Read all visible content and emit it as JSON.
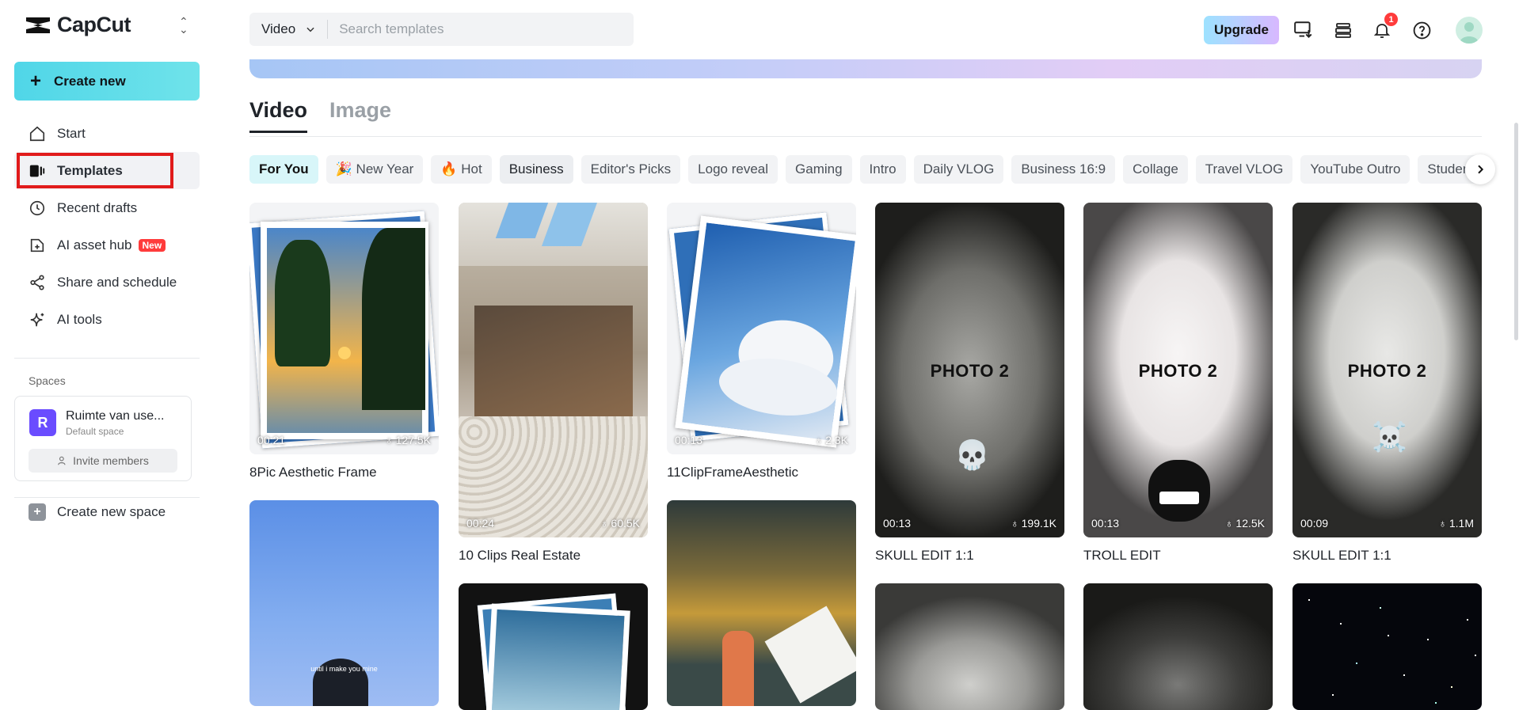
{
  "app": {
    "name": "CapCut"
  },
  "sidebar": {
    "create_label": "Create new",
    "items": [
      {
        "label": "Start",
        "icon": "home-icon"
      },
      {
        "label": "Templates",
        "icon": "templates-icon"
      },
      {
        "label": "Recent drafts",
        "icon": "clock-icon"
      },
      {
        "label": "AI asset hub",
        "icon": "asset-hub-icon",
        "badge": "New"
      },
      {
        "label": "Share and schedule",
        "icon": "share-icon"
      },
      {
        "label": "AI tools",
        "icon": "sparkle-icon"
      }
    ],
    "spaces_label": "Spaces",
    "space": {
      "initial": "R",
      "name": "Ruimte van use...",
      "subtitle": "Default space",
      "invite_label": "Invite members"
    },
    "create_space_label": "Create new space"
  },
  "topbar": {
    "search_type": "Video",
    "search_placeholder": "Search templates",
    "upgrade_label": "Upgrade",
    "notification_count": "1"
  },
  "tabs": [
    {
      "label": "Video",
      "active": true
    },
    {
      "label": "Image",
      "active": false
    }
  ],
  "chips": [
    "For You",
    "🎉 New Year",
    "🔥 Hot",
    "Business",
    "Editor's Picks",
    "Logo reveal",
    "Gaming",
    "Intro",
    "Daily VLOG",
    "Business 16:9",
    "Collage",
    "Travel VLOG",
    "YouTube Outro",
    "Student"
  ],
  "cards": [
    {
      "title": "8Pic Aesthetic Frame",
      "duration": "00:21",
      "views": "127.5K"
    },
    {
      "title": "10 Clips Real Estate",
      "duration": "00:24",
      "views": "60.5K"
    },
    {
      "title": "11ClipFrameAesthetic",
      "duration": "00:13",
      "views": "2.3K"
    },
    {
      "title": "SKULL EDIT 1:1",
      "duration": "00:13",
      "views": "199.1K",
      "overlay": "PHOTO 2"
    },
    {
      "title": "TROLL EDIT",
      "duration": "00:13",
      "views": "12.5K",
      "overlay": "PHOTO 2"
    },
    {
      "title": "SKULL EDIT 1:1",
      "duration": "00:09",
      "views": "1.1M",
      "overlay": "PHOTO 2"
    }
  ],
  "card_small_caption": "until i make you mine"
}
